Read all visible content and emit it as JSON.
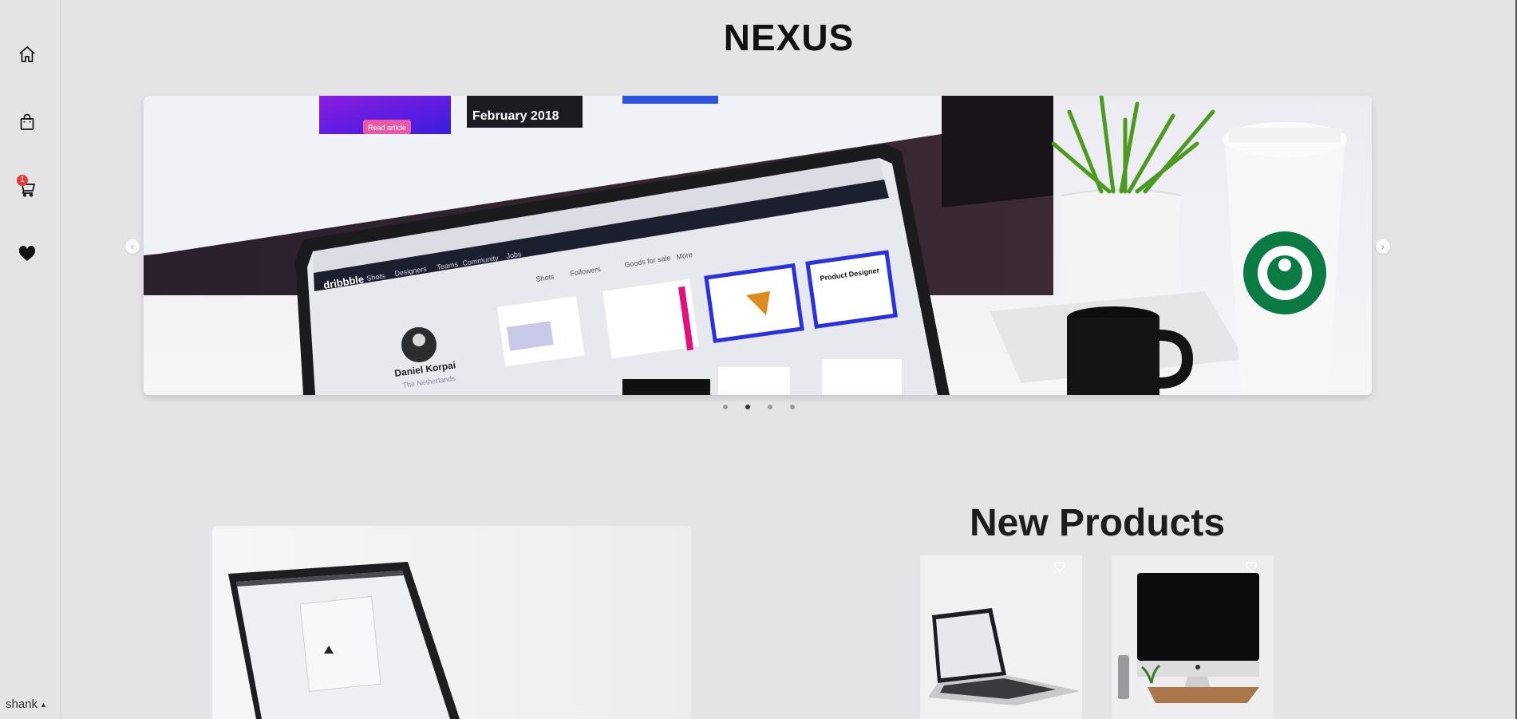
{
  "brand": "NEXUS",
  "sidebar": {
    "items": [
      {
        "name": "home-icon",
        "label": "Home"
      },
      {
        "name": "shopping-bag-icon",
        "label": "Shop"
      },
      {
        "name": "cart-icon",
        "label": "Cart"
      },
      {
        "name": "heart-icon",
        "label": "Wishlist"
      }
    ],
    "cart_count": "1",
    "user": "shank"
  },
  "carousel": {
    "slides": 4,
    "active_index": 1,
    "prev_icon": "chevron-left-icon",
    "next_icon": "chevron-right-icon",
    "screen_texts": {
      "article_button": "Read article",
      "article_date": "February 2018",
      "site": "dribbble",
      "nav": [
        "Shots",
        "Designers",
        "Teams",
        "Community",
        "Jobs"
      ],
      "tabs": [
        "Shots",
        "Followers",
        "Goods for sale",
        "More"
      ],
      "profile_name": "Daniel Korpai",
      "profile_location": "The Netherlands",
      "card_label": "Product Designer"
    }
  },
  "new_products": {
    "title": "New Products",
    "items": [
      {
        "name": "laptop-product",
        "fav_icon": "heart-outline-icon"
      },
      {
        "name": "imac-product",
        "fav_icon": "heart-outline-icon"
      }
    ]
  },
  "colors": {
    "background": "#e4e4e7",
    "badge": "#e53935",
    "text": "#111111"
  }
}
